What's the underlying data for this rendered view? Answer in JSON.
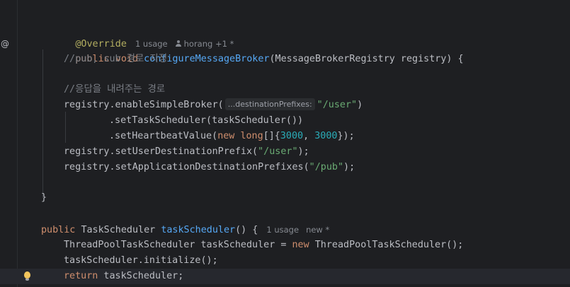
{
  "editor": {
    "inlays": {
      "usage_1": "1 usage",
      "author": "horang +1 *",
      "param_hint": "...destinationPrefixes:",
      "usage_2": "1 usage",
      "new_marker": "new *"
    },
    "code": {
      "l1_annotation": "@Override",
      "l2_public": "public",
      "l2_void": "void",
      "l2_method": "configureMessageBroker",
      "l2_rest": "(MessageBrokerRegistry registry) {",
      "l3_comment": "//pub, sub 경로 지정",
      "l5_comment": "//응답을 내려주는 경로",
      "l6_call": "registry.enableSimpleBroker(",
      "l6_str": "\"/user\"",
      "l6_end": ")",
      "l7": ".setTaskScheduler(taskScheduler())",
      "l8_call": ".setHeartbeatValue(",
      "l8_new": "new",
      "l8_long": "long",
      "l8_mid": "[]{",
      "l8_n1": "3000",
      "l8_comma": ", ",
      "l8_n2": "3000",
      "l8_end": "});",
      "l9_call": "registry.setUserDestinationPrefix(",
      "l9_str": "\"/user\"",
      "l9_end": ");",
      "l10_call": "registry.setApplicationDestinationPrefixes(",
      "l10_str": "\"/pub\"",
      "l10_end": ");",
      "l12_brace": "}",
      "l14_public": "public",
      "l14_type": "TaskScheduler",
      "l14_method": "taskScheduler",
      "l14_rest": "() {",
      "l15_decl": "ThreadPoolTaskScheduler taskScheduler = ",
      "l15_new": "new",
      "l15_rest": " ThreadPoolTaskScheduler();",
      "l16": "taskScheduler.initialize();",
      "l17_return": "return",
      "l17_rest": " taskScheduler;"
    }
  },
  "colors": {
    "background": "#1e1f22",
    "keyword": "#cf8e6d",
    "method": "#56a8f5",
    "annotation": "#b3ae60",
    "string": "#6aab73",
    "number": "#2aacb8",
    "comment": "#7a7e85"
  },
  "icons": [
    "at-icon",
    "user-icon",
    "bulb-icon"
  ]
}
